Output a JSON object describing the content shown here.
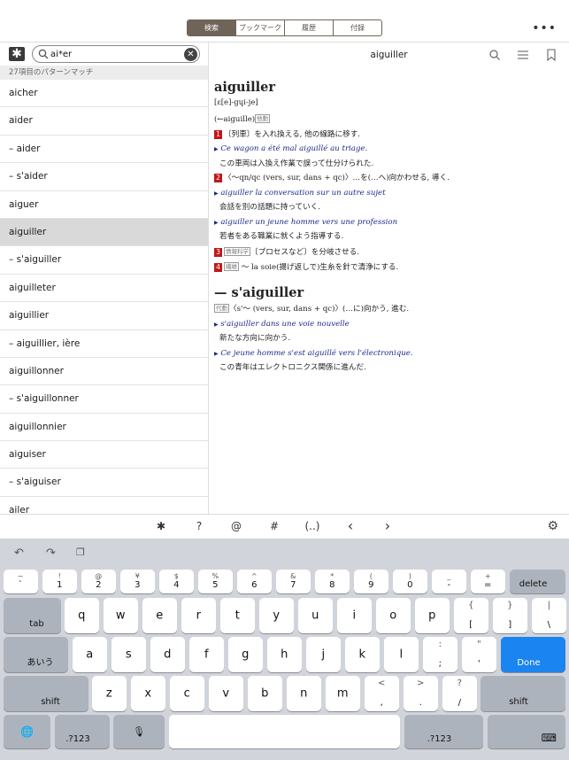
{
  "toolbar": {
    "tabs": [
      "検索",
      "ブックマーク",
      "履歴",
      "付録"
    ],
    "more": "•••"
  },
  "search": {
    "wildcard_btn": "✱",
    "query": "ai*er",
    "match_text": "27項目のパターンマッチ"
  },
  "results": [
    "aicher",
    "aider",
    "– aider",
    "– s'aider",
    "aiguer",
    "aiguiller",
    "– s'aiguiller",
    "aiguilleter",
    "aiguillier",
    "– aiguillier, ière",
    "aiguillonner",
    "– s'aiguillonner",
    "aiguillonnier",
    "aiguiser",
    "– s'aiguiser",
    "ailer"
  ],
  "selected_index": 5,
  "entry": {
    "header_title": "aiguiller",
    "headword": "aiguiller",
    "pron": "[ɛ[e]-gɥi-je]",
    "origin": "(←aiguille)",
    "pos_tag": "他動",
    "s1_num": "1",
    "s1_text": "〔列車〕を入れ換える, 他の線路に移す.",
    "s1_ex_fr": "Ce wagon a été mal aiguillé au triage.",
    "s1_ex_ja": "この車両は入換え作業で誤って仕分けられた.",
    "s2_num": "2",
    "s2_text": "〈～qn/qc (vers, sur, dans + qc)〉…を(…へ)向かわせる, 導く.",
    "s2_ex1_fr": "aiguiller la conversation sur un autre sujet",
    "s2_ex1_ja": "会話を別の話題に持っていく.",
    "s2_ex2_fr": "aiguiller un jeune homme vers une profession",
    "s2_ex2_ja": "若者をある職業に就くよう指導する.",
    "s3_num": "3",
    "s3_tag": "情報科学",
    "s3_text": "〔プロセスなど〕を分岐させる.",
    "s4_num": "4",
    "s4_tag": "繊維",
    "s4_text": "～ la soie(揚げ返しで)生糸を針で清浄にする.",
    "sub_headword": "— s'aiguiller",
    "sub_tag": "代動",
    "sub_text": "〈s'～ (vers, sur, dans + qc)〉(…に)向かう, 進む.",
    "sub_ex1_fr": "s'aiguiller dans une voie nouvelle",
    "sub_ex1_ja": "新たな方向に向かう.",
    "sub_ex2_fr": "Ce jeune homme s'est aiguillé vers l'électronique.",
    "sub_ex2_ja": "この青年はエレクトロニクス関係に進んだ."
  },
  "symbols": [
    "✱",
    "?",
    "@",
    "#",
    "(..)",
    "‹",
    "›"
  ],
  "keyboard": {
    "num_row": [
      [
        "~",
        "`"
      ],
      [
        "!",
        "1"
      ],
      [
        "@",
        "2"
      ],
      [
        "¥",
        "3"
      ],
      [
        "$",
        "4"
      ],
      [
        "%",
        "5"
      ],
      [
        "^",
        "6"
      ],
      [
        "&",
        "7"
      ],
      [
        "*",
        "8"
      ],
      [
        "(",
        "9"
      ],
      [
        ")",
        "0"
      ],
      [
        "_",
        "-"
      ],
      [
        "+",
        "="
      ]
    ],
    "delete": "delete",
    "tab": "tab",
    "q_row": [
      "q",
      "w",
      "e",
      "r",
      "t",
      "y",
      "u",
      "i",
      "o",
      "p"
    ],
    "q_extra": [
      [
        "{",
        "["
      ],
      [
        "}",
        "]"
      ],
      [
        "|",
        "\\"
      ]
    ],
    "aiu": "あいう",
    "a_row": [
      "a",
      "s",
      "d",
      "f",
      "g",
      "h",
      "j",
      "k",
      "l"
    ],
    "a_extra": [
      [
        ":",
        ";"
      ],
      [
        "\"",
        "'"
      ]
    ],
    "done": "Done",
    "shift": "shift",
    "z_row": [
      "z",
      "x",
      "c",
      "v",
      "b",
      "n",
      "m"
    ],
    "z_extra": [
      [
        "<",
        ","
      ],
      [
        ">",
        "."
      ],
      [
        "?",
        "/"
      ]
    ],
    "num_toggle": ".?123"
  }
}
